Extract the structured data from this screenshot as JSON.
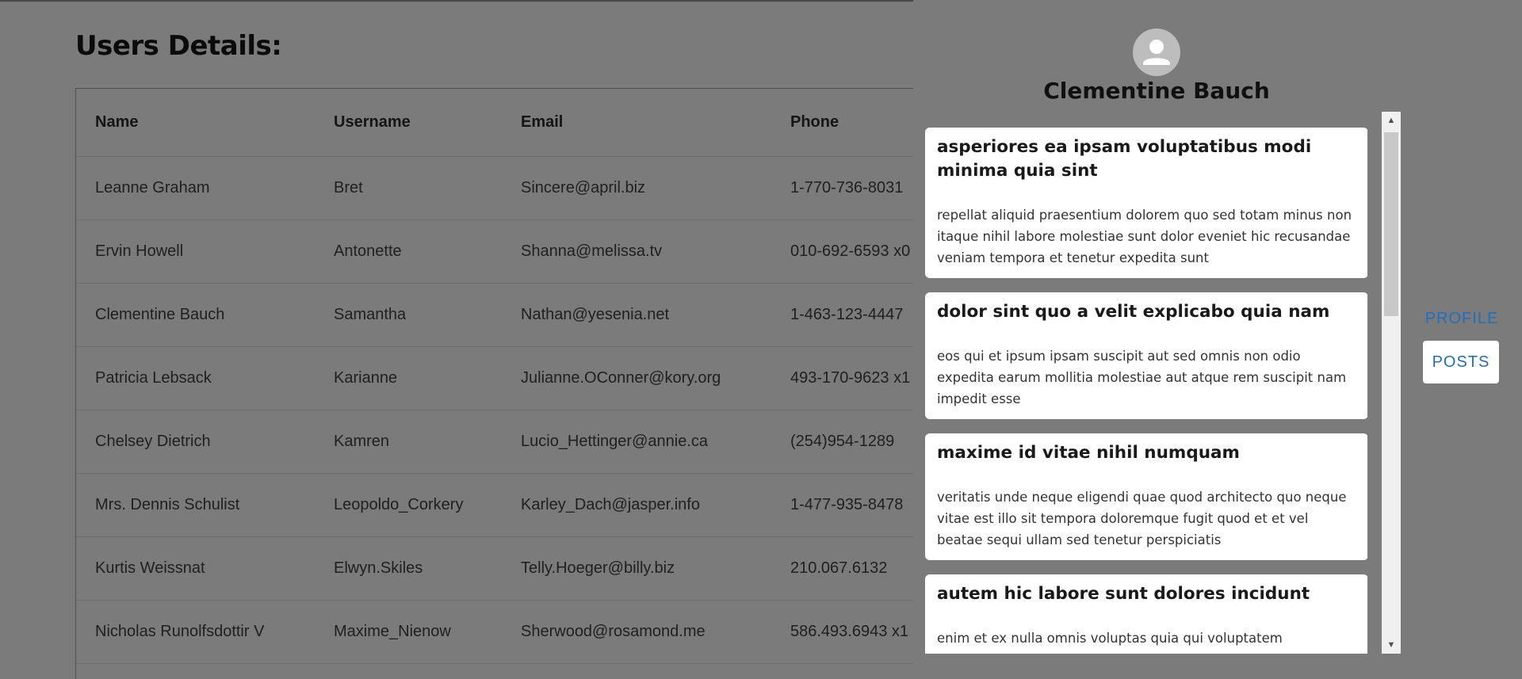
{
  "page": {
    "title": "Users Details:"
  },
  "table": {
    "headers": [
      "Name",
      "Username",
      "Email",
      "Phone"
    ],
    "rows": [
      [
        "Leanne Graham",
        "Bret",
        "Sincere@april.biz",
        "1-770-736-8031"
      ],
      [
        "Ervin Howell",
        "Antonette",
        "Shanna@melissa.tv",
        "010-692-6593 x0"
      ],
      [
        "Clementine Bauch",
        "Samantha",
        "Nathan@yesenia.net",
        "1-463-123-4447"
      ],
      [
        "Patricia Lebsack",
        "Karianne",
        "Julianne.OConner@kory.org",
        "493-170-9623 x1"
      ],
      [
        "Chelsey Dietrich",
        "Kamren",
        "Lucio_Hettinger@annie.ca",
        "(254)954-1289"
      ],
      [
        "Mrs. Dennis Schulist",
        "Leopoldo_Corkery",
        "Karley_Dach@jasper.info",
        "1-477-935-8478"
      ],
      [
        "Kurtis Weissnat",
        "Elwyn.Skiles",
        "Telly.Hoeger@billy.biz",
        "210.067.6132"
      ],
      [
        "Nicholas Runolfsdottir V",
        "Maxime_Nienow",
        "Sherwood@rosamond.me",
        "586.493.6943 x1"
      ]
    ]
  },
  "drawer": {
    "user_name": "Clementine Bauch",
    "avatar_icon": "person-icon",
    "tabs": {
      "profile_label": "PROFILE",
      "posts_label": "POSTS",
      "active": "POSTS"
    },
    "posts": [
      {
        "title": "asperiores ea ipsam voluptatibus modi minima quia sint",
        "body": "repellat aliquid praesentium dolorem quo sed totam minus non itaque nihil labore molestiae sunt dolor eveniet hic recusandae veniam tempora et tenetur expedita sunt"
      },
      {
        "title": "dolor sint quo a velit explicabo quia nam",
        "body": "eos qui et ipsum ipsam suscipit aut sed omnis non odio expedita earum mollitia molestiae aut atque rem suscipit nam impedit esse"
      },
      {
        "title": "maxime id vitae nihil numquam",
        "body": "veritatis unde neque eligendi quae quod architecto quo neque vitae est illo sit tempora doloremque fugit quod et et vel beatae sequi ullam sed tenetur perspiciatis"
      },
      {
        "title": "autem hic labore sunt dolores incidunt",
        "body": "enim et ex nulla omnis voluptas quia qui voluptatem consequatur"
      }
    ]
  },
  "colors": {
    "overlay_bg": "#7b7b7b",
    "accent": "#1f6fc2",
    "card_bg": "#ffffff"
  }
}
